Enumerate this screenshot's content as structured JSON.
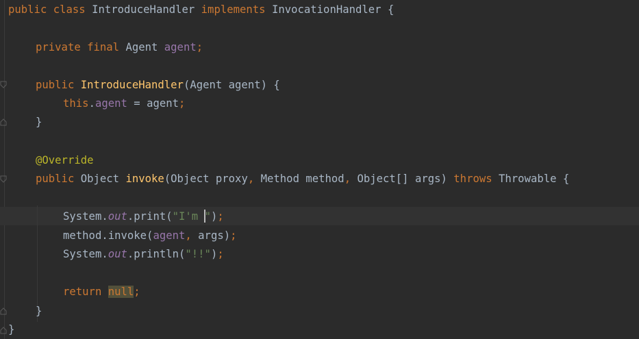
{
  "editor": {
    "language": "java",
    "theme": "darcula",
    "caret_line": 11,
    "colors": {
      "background": "#2b2b2b",
      "caret_row": "#323232",
      "keyword": "#cc7832",
      "method_decl": "#ffc66d",
      "field": "#9876aa",
      "string": "#6a8759",
      "annotation": "#bbb529",
      "text": "#a9b7c6",
      "null_highlight": "#52503a"
    },
    "icons": [
      "fold-marker-icon"
    ]
  },
  "code": {
    "line1": {
      "kw1": "public class ",
      "name": "IntroduceHandler ",
      "kw2": "implements ",
      "iface": "InvocationHandler {"
    },
    "line3": {
      "kw": "private final ",
      "type": "Agent ",
      "field": "agent",
      "semi": ";"
    },
    "line5": {
      "kw": "public ",
      "name": "IntroduceHandler",
      "params": "(Agent agent) {"
    },
    "line6": {
      "kw": "this",
      "dot": ".",
      "field": "agent",
      "rest": " = agent",
      "semi": ";"
    },
    "line7": {
      "brace": "}"
    },
    "line9": {
      "annotation": "@Override"
    },
    "line10": {
      "kw": "public ",
      "type": "Object ",
      "name": "invoke",
      "p1": "(Object proxy",
      "c1": ", ",
      "p2": "Method method",
      "c2": ", ",
      "p3": "Object[] args) ",
      "throws": "throws ",
      "exc": "Throwable {"
    },
    "line12": {
      "cls": "System.",
      "field": "out",
      "call": ".print(",
      "str_before_caret": "\"I'm ",
      "str_after_caret": "\"",
      "close": ")",
      "semi": ";"
    },
    "line13": {
      "call": "method.invoke(",
      "field": "agent",
      "comma": ", ",
      "rest": "args)",
      "semi": ";"
    },
    "line14": {
      "cls": "System.",
      "field": "out",
      "call": ".println(",
      "str": "\"!!\"",
      "close": ")",
      "semi": ";"
    },
    "line16": {
      "kw": "return ",
      "null": "null",
      "semi": ";"
    },
    "line17": {
      "brace": "}"
    },
    "line18": {
      "brace": "}"
    }
  }
}
